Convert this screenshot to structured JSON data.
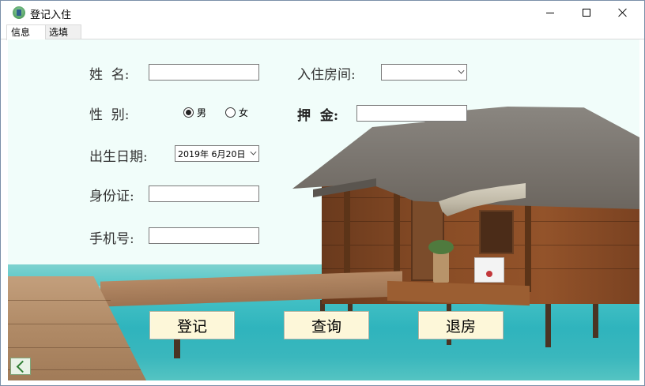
{
  "window": {
    "title": "登记入住"
  },
  "tabs": [
    {
      "label": "信息"
    },
    {
      "label": "选填"
    }
  ],
  "form": {
    "name_label": "姓  名:",
    "name_value": "",
    "gender_label": "性  别:",
    "gender_options": [
      {
        "label": "男",
        "selected": true
      },
      {
        "label": "女",
        "selected": false
      }
    ],
    "birthdate_label": "出生日期:",
    "birthdate_value": "2019年 6月20日",
    "id_label": "身份证:",
    "id_value": "",
    "phone_label": "手机号:",
    "phone_value": "",
    "room_label": "入住房间:",
    "room_value": "",
    "deposit_label": "押  金:",
    "deposit_value": ""
  },
  "actions": {
    "register_label": "登记",
    "query_label": "查询",
    "checkout_label": "退房"
  },
  "icons": {
    "app": "hotel-app-icon",
    "back": "back-arrow-icon"
  },
  "colors": {
    "background": "#f1fdfa",
    "button_fill": "#fdf7d9",
    "sea": "#3ab7bd"
  }
}
